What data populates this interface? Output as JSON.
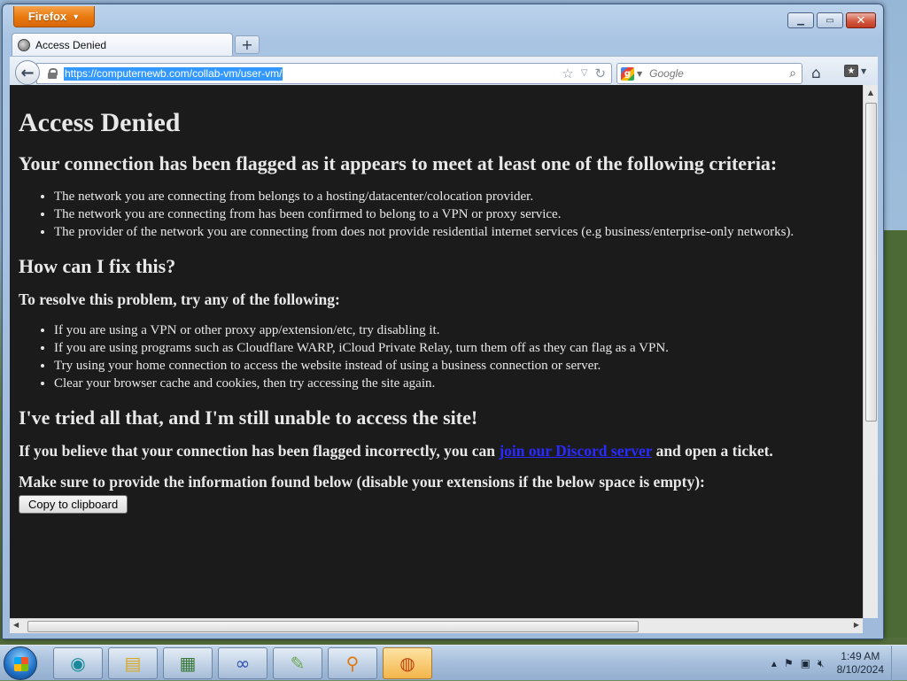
{
  "browser": {
    "app_button_label": "Firefox",
    "tab_title": "Access Denied",
    "url": "https://computernewb.com/collab-vm/user-vm/",
    "search_placeholder": "Google"
  },
  "page": {
    "title": "Access Denied",
    "criteria_heading": "Your connection has been flagged as it appears to meet at least one of the following criteria:",
    "criteria": [
      "The network you are connecting from belongs to a hosting/datacenter/colocation provider.",
      "The network you are connecting from has been confirmed to belong to a VPN or proxy service.",
      "The provider of the network you are connecting from does not provide residential internet services (e.g business/enterprise-only networks)."
    ],
    "fix_heading": "How can I fix this?",
    "resolve_intro": "To resolve this problem, try any of the following:",
    "fixes": [
      "If you are using a VPN or other proxy app/extension/etc, try disabling it.",
      "If you are using programs such as Cloudflare WARP, iCloud Private Relay, turn them off as they can flag as a VPN.",
      "Try using your home connection to access the website instead of using a business connection or server.",
      "Clear your browser cache and cookies, then try accessing the site again."
    ],
    "still_heading": "I've tried all that, and I'm still unable to access the site!",
    "flagged_prefix": "If you believe that your connection has been flagged incorrectly, you can ",
    "discord_link": "join our Discord server",
    "flagged_suffix": " and open a ticket.",
    "provide_info": "Make sure to provide the information found below (disable your extensions if the below space is empty):",
    "copy_button": "Copy to clipboard"
  },
  "taskbar": {
    "time": "1:49 AM",
    "date": "8/10/2024"
  },
  "colors": {
    "page_background": "#1b1b1b",
    "page_text": "#e8e8e8",
    "link": "#2a2aff",
    "firefox_button": "#e8780c"
  }
}
